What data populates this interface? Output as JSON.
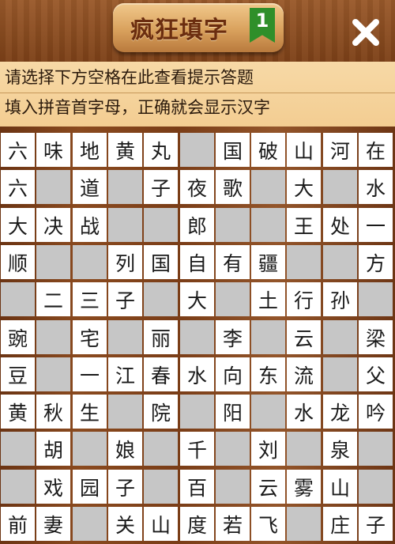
{
  "header": {
    "title": "疯狂填字",
    "level": "1",
    "close_icon": "close-icon"
  },
  "hints": {
    "line1": "请选择下方空格在此查看提示答题",
    "line2": "填入拼音首字母，正确就会显示汉字"
  },
  "grid": {
    "rows": [
      [
        "六",
        "味",
        "地",
        "黄",
        "丸",
        "",
        "国",
        "破",
        "山",
        "河",
        "在"
      ],
      [
        "六",
        "",
        "道",
        "",
        "子",
        "夜",
        "歌",
        "",
        "大",
        "",
        "水"
      ],
      [
        "大",
        "决",
        "战",
        "",
        "",
        "郎",
        "",
        "",
        "王",
        "处",
        "一"
      ],
      [
        "顺",
        "",
        "",
        "列",
        "国",
        "自",
        "有",
        "疆",
        "",
        "",
        "方"
      ],
      [
        "",
        "二",
        "三",
        "子",
        "",
        "大",
        "",
        "土",
        "行",
        "孙",
        ""
      ],
      [
        "豌",
        "",
        "宅",
        "",
        "丽",
        "",
        "李",
        "",
        "云",
        "",
        "梁"
      ],
      [
        "豆",
        "",
        "一",
        "江",
        "春",
        "水",
        "向",
        "东",
        "流",
        "",
        "父"
      ],
      [
        "黄",
        "秋",
        "生",
        "",
        "院",
        "",
        "阳",
        "",
        "水",
        "龙",
        "吟"
      ],
      [
        "",
        "胡",
        "",
        "娘",
        "",
        "千",
        "",
        "刘",
        "",
        "泉",
        ""
      ],
      [
        "",
        "戏",
        "园",
        "子",
        "",
        "百",
        "",
        "云",
        "雾",
        "山",
        ""
      ],
      [
        "前",
        "妻",
        "",
        "关",
        "山",
        "度",
        "若",
        "飞",
        "",
        "庄",
        "子"
      ]
    ]
  },
  "colors": {
    "wood": "#7a3d17",
    "hint_bg": "#f5d39b",
    "cell_filled": "#ffffff",
    "cell_empty": "#c6c6c6"
  }
}
